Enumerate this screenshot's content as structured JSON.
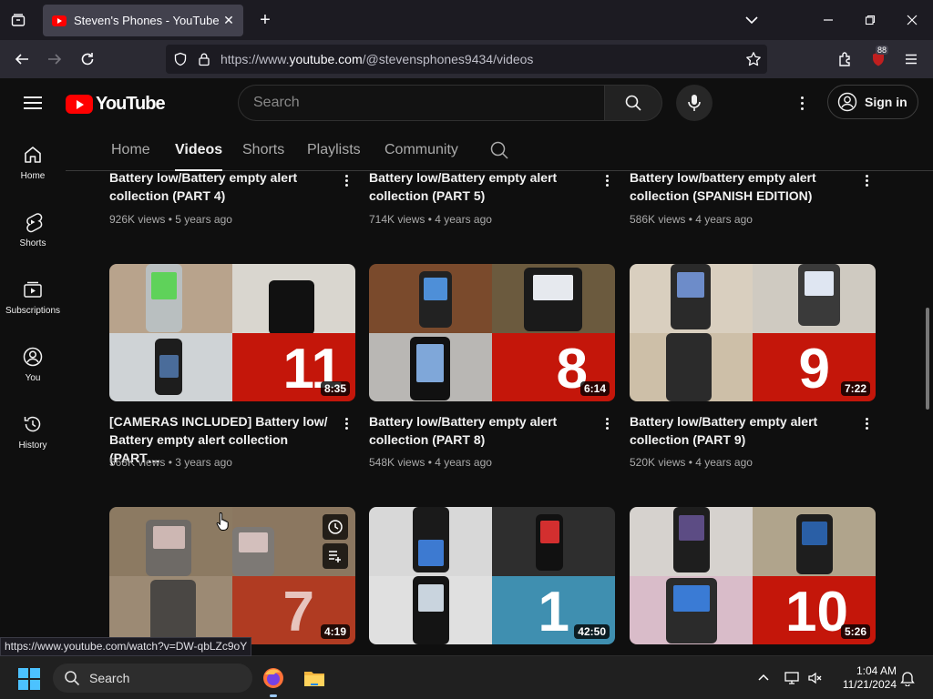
{
  "browser": {
    "tab_title": "Steven's Phones - YouTube",
    "url_prefix": "https://www.",
    "url_domain": "youtube.com",
    "url_path": "/@stevensphones9434/videos",
    "extension_badge": "88"
  },
  "youtube": {
    "logo_text": "YouTube",
    "search_placeholder": "Search",
    "sign_in": "Sign in",
    "guide": [
      {
        "label": "Home",
        "icon": "home-icon"
      },
      {
        "label": "Shorts",
        "icon": "shorts-icon"
      },
      {
        "label": "Subscriptions",
        "icon": "subscriptions-icon"
      },
      {
        "label": "You",
        "icon": "you-icon"
      },
      {
        "label": "History",
        "icon": "history-icon"
      }
    ],
    "channel_tabs": [
      "Home",
      "Videos",
      "Shorts",
      "Playlists",
      "Community"
    ],
    "active_tab": "Videos",
    "videos_row0": [
      {
        "title": "Battery low/Battery empty alert collection (PART 4)",
        "views": "926K views",
        "age": "5 years ago"
      },
      {
        "title": "Battery low/Battery empty alert collection (PART 5)",
        "views": "714K views",
        "age": "4 years ago"
      },
      {
        "title": "Battery low/battery empty alert collection (SPANISH EDITION)",
        "views": "586K views",
        "age": "4 years ago"
      }
    ],
    "videos_row1": [
      {
        "title": "[CAMERAS INCLUDED] Battery low/ Battery empty alert collection (PART…",
        "views": "568K views",
        "age": "3 years ago",
        "number": "11",
        "duration": "8:35"
      },
      {
        "title": "Battery low/Battery empty alert collection (PART 8)",
        "views": "548K views",
        "age": "4 years ago",
        "number": "8",
        "duration": "6:14"
      },
      {
        "title": "Battery low/Battery empty alert collection (PART 9)",
        "views": "520K views",
        "age": "4 years ago",
        "number": "9",
        "duration": "7:22"
      }
    ],
    "videos_row2": [
      {
        "number": "7",
        "duration": "4:19"
      },
      {
        "number": "1",
        "duration": "42:50"
      },
      {
        "number": "10",
        "duration": "5:26"
      }
    ]
  },
  "status_url": "https://www.youtube.com/watch?v=DW-qbLZc9oY",
  "taskbar": {
    "search_label": "Search",
    "time": "1:04 AM",
    "date": "11/21/2024"
  },
  "colors": {
    "accent_red": "#ff0000",
    "thumb_red": "#c4160a",
    "thumb_blue": "#3f8fb0"
  }
}
